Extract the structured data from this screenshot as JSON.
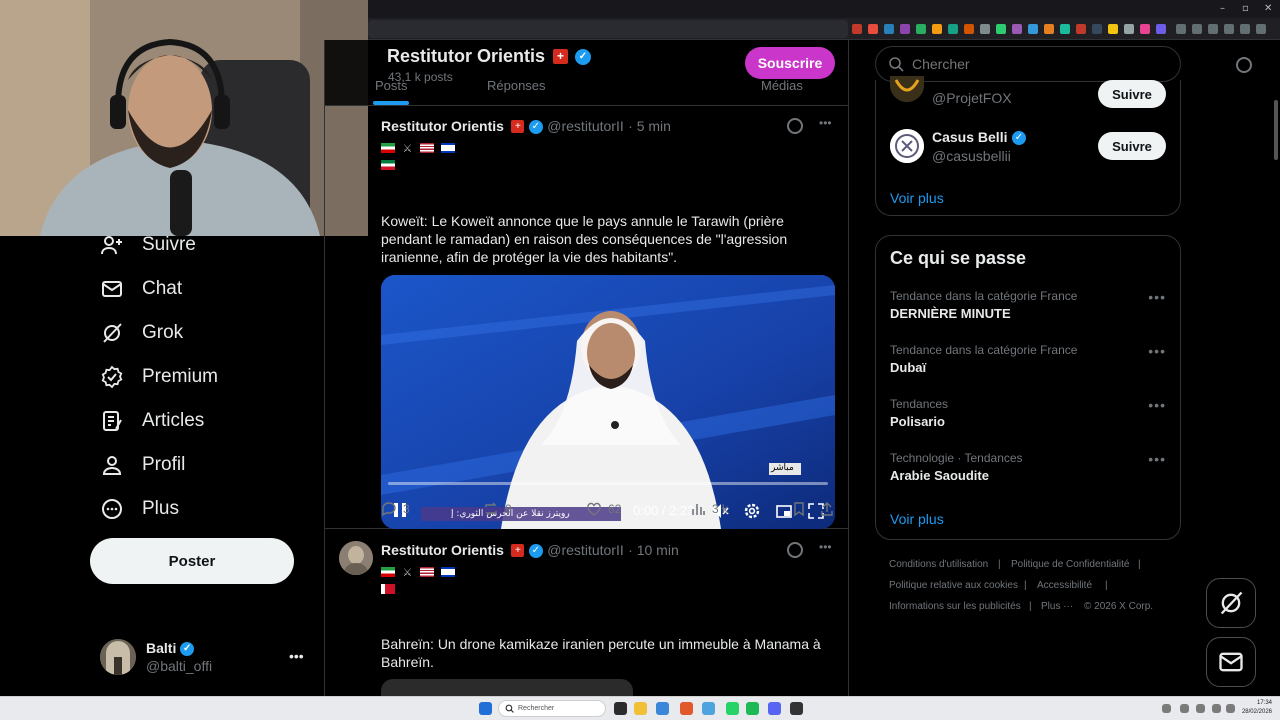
{
  "colors": {
    "accent": "#1d9bf0",
    "subscribe": "#c936c9",
    "background": "#000000",
    "muted": "#71767b",
    "text": "#e7e9ea"
  },
  "header": {
    "title": "Restitutor Orientis",
    "posts_count": "43,1 k posts",
    "subscribe_label": "Souscrire",
    "tabs": [
      "Posts",
      "Réponses",
      "Médias"
    ]
  },
  "sidebar": {
    "items": [
      {
        "label": "Suivre",
        "icon": "person-add-icon"
      },
      {
        "label": "Chat",
        "icon": "mail-icon"
      },
      {
        "label": "Grok",
        "icon": "grok-icon"
      },
      {
        "label": "Premium",
        "icon": "verified-badge-icon"
      },
      {
        "label": "Articles",
        "icon": "article-icon"
      },
      {
        "label": "Profil",
        "icon": "person-icon"
      },
      {
        "label": "Plus",
        "icon": "more-circle-icon"
      }
    ],
    "post_button": "Poster",
    "account": {
      "name": "Balti",
      "handle": "@balti_offi"
    }
  },
  "tweets": [
    {
      "name": "Restitutor Orientis",
      "handle": "@restitutorII",
      "time": "· 5 min",
      "text": "Koweït: Le Koweït annonce que le pays annule le Tarawih (prière pendant le ramadan) en raison des conséquences de \"l'agression iranienne, afin de protéger la vie des habitants\".",
      "video": {
        "time": "0:00 / 2:23",
        "live_badge": "مباشر",
        "caption": "رويترز نقلا عن الحرس الثوري: إ"
      },
      "replies": "3",
      "reposts": "9",
      "likes": "62",
      "views": "3 k"
    },
    {
      "name": "Restitutor Orientis",
      "handle": "@restitutorII",
      "time": "· 10 min",
      "text": "Bahreïn: Un drone kamikaze iranien percute un immeuble à Manama à Bahreïn."
    }
  ],
  "right": {
    "search_placeholder": "Chercher",
    "who_to_follow": [
      {
        "handle": "@ProjetFOX",
        "button": "Suivre"
      },
      {
        "name": "Casus Belli",
        "handle": "@casusbellii",
        "button": "Suivre"
      }
    ],
    "see_more": "Voir plus",
    "trends_title": "Ce qui se passe",
    "trends": [
      {
        "category": "Tendance dans la catégorie France",
        "name": "DERNIÈRE MINUTE"
      },
      {
        "category": "Tendance dans la catégorie France",
        "name": "Dubaï"
      },
      {
        "category": "Tendances",
        "name": "Polisario"
      },
      {
        "category": "Technologie · Tendances",
        "name": "Arabie Saoudite"
      }
    ],
    "trends_see_more": "Voir plus",
    "footer": {
      "terms": "Conditions d'utilisation",
      "privacy": "Politique de Confidentialité",
      "cookies": "Politique relative aux cookies",
      "accessibility": "Accessibilité",
      "ads": "Informations sur les publicités",
      "more": "Plus ···",
      "copyright": "© 2026 X Corp."
    }
  },
  "taskbar": {
    "search_placeholder": "Rechercher",
    "clock_time": "17:34",
    "clock_date": "28/02/2026"
  }
}
